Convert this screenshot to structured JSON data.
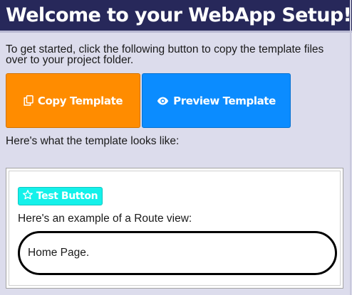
{
  "header": {
    "title": "Welcome to your WebApp Setup!"
  },
  "intro": {
    "text": "To get started, click the following button to copy the template files over to your project folder."
  },
  "actions": {
    "copy_label": "Copy Template",
    "copy_icon": "copy-icon",
    "preview_label": "Preview Template",
    "preview_icon": "eye-icon"
  },
  "preview_heading": "Here's what the template looks like:",
  "template_preview": {
    "test_button_label": "Test Button",
    "test_button_icon": "star-icon",
    "route_heading": "Here's an example of a Route view:",
    "route_content": "Home Page."
  },
  "colors": {
    "header_bg": "#27285a",
    "page_bg": "#dcdcec",
    "copy_button": "#ff8c00",
    "preview_button": "#0b8cff",
    "test_button": "#14f1ea"
  }
}
